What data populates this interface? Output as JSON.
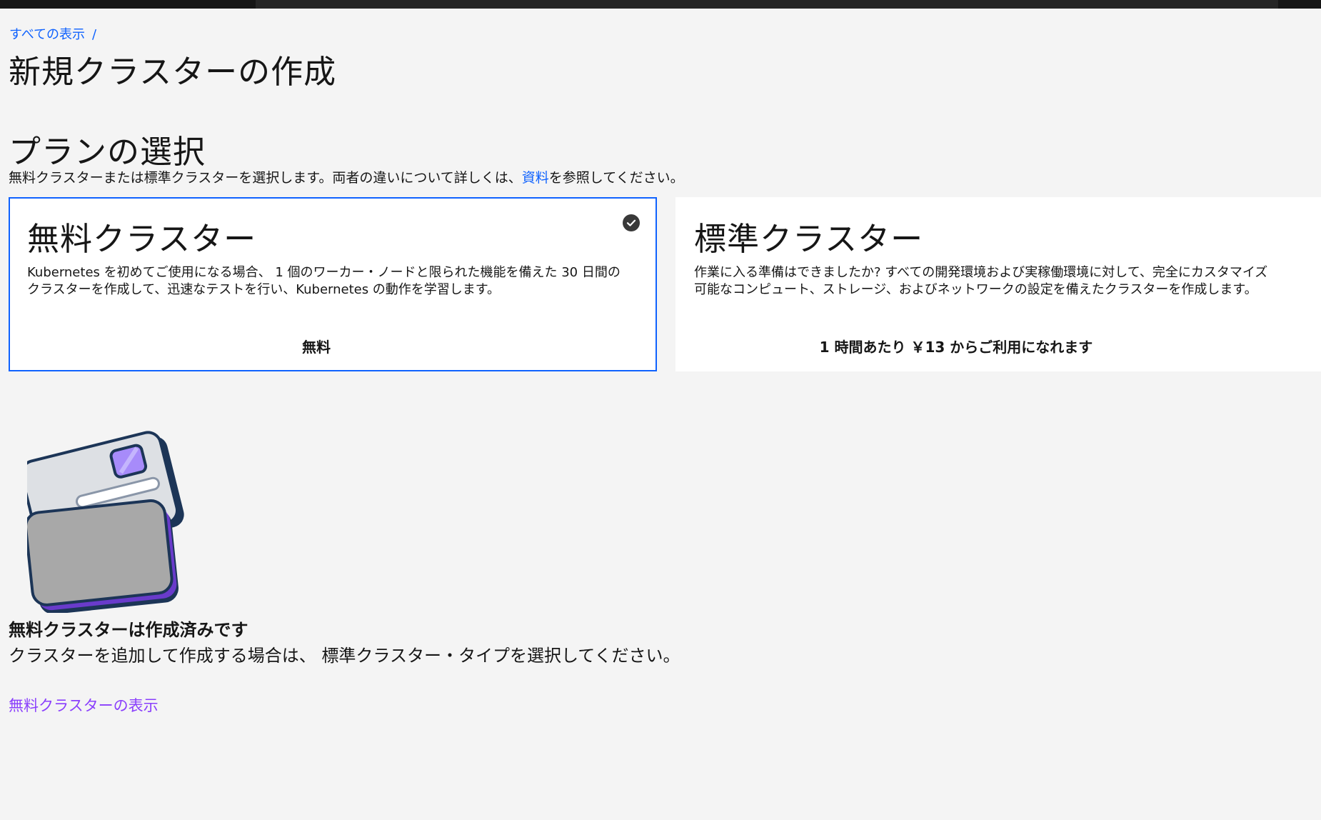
{
  "colors": {
    "link": "#0f62fe",
    "visited_link": "#8a3ffc",
    "selected_border": "#0f62fe",
    "background": "#f4f4f4",
    "card": "#ffffff"
  },
  "breadcrumb": {
    "items": [
      {
        "label": "すべての表示",
        "separator": "/"
      }
    ]
  },
  "page_title": "新規クラスターの作成",
  "plan_section": {
    "title": "プランの選択",
    "description_before": "無料クラスターまたは標準クラスターを選択します。両者の違いについて詳しくは、",
    "description_link": "資料",
    "description_after": "を参照してください。"
  },
  "plans": [
    {
      "name": "無料クラスター",
      "description": "Kubernetes を初めてご使用になる場合、 1 個のワーカー・ノードと限られた機能を備えた 30 日間のクラスターを作成して、迅速なテストを行い、Kubernetes の動作を学習します。",
      "price": "無料",
      "selected": true,
      "icon": "checkmark-filled-icon"
    },
    {
      "name": "標準クラスター",
      "description": "作業に入る準備はできましたか? すべての開発環境および実稼働環境に対して、完全にカスタマイズ可能なコンピュート、ストレージ、およびネットワークの設定を備えたクラスターを作成します。",
      "price": "1 時間あたり ￥13 からご利用になれます",
      "selected": false
    }
  ],
  "notice": {
    "illustration": "cluster-cards-illustration",
    "title": "無料クラスターは作成済みです",
    "text": "クラスターを追加して作成する場合は、 標準クラスター・タイプを選択してください。",
    "link": "無料クラスターの表示"
  }
}
